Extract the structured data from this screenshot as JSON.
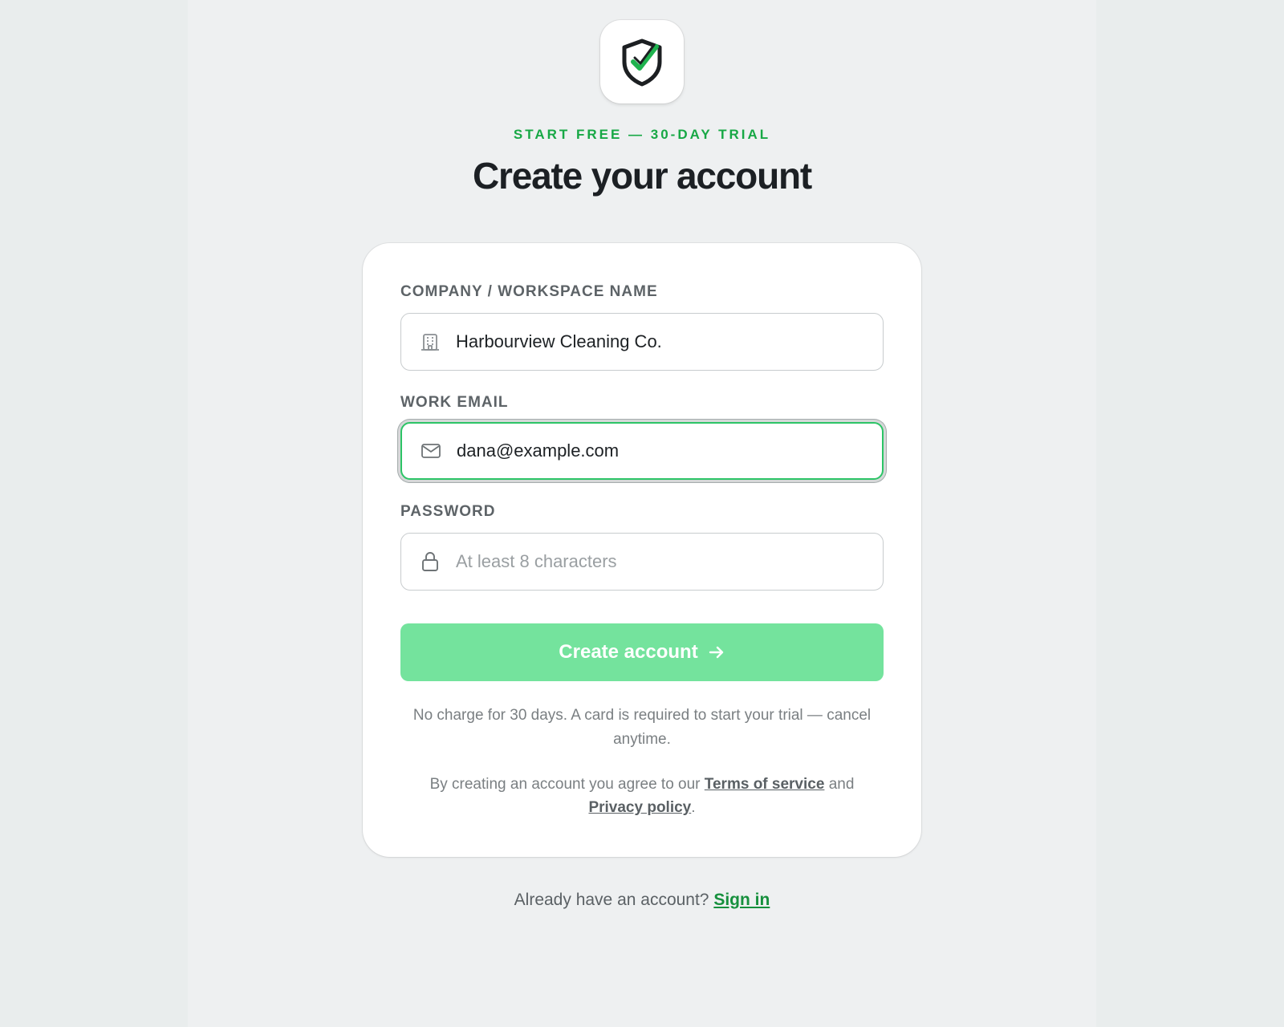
{
  "header": {
    "eyebrow": "START FREE — 30-DAY TRIAL",
    "title": "Create your account"
  },
  "logo": {
    "icon": "shield-check-icon"
  },
  "form": {
    "company": {
      "label": "COMPANY / WORKSPACE NAME",
      "value": "Harbourview Cleaning Co.",
      "icon": "building-icon"
    },
    "email": {
      "label": "WORK EMAIL",
      "value": "dana@example.com",
      "icon": "mail-icon"
    },
    "password": {
      "label": "PASSWORD",
      "value": "",
      "placeholder": "At least 8 characters",
      "icon": "lock-icon"
    },
    "submit_label": "Create account",
    "note": "No charge for 30 days. A card is required to start your trial — cancel anytime.",
    "legal": {
      "prefix": "By creating an account you agree to our",
      "terms_link": "Terms of service",
      "and": "and",
      "privacy_link": "Privacy policy",
      "suffix": "."
    }
  },
  "footer": {
    "prompt": "Already have an account?",
    "signin_link": "Sign in"
  },
  "colors": {
    "accent": "#17a845",
    "button": "#74e39d",
    "focus_border": "#2cc466",
    "link_green": "#16903d"
  }
}
